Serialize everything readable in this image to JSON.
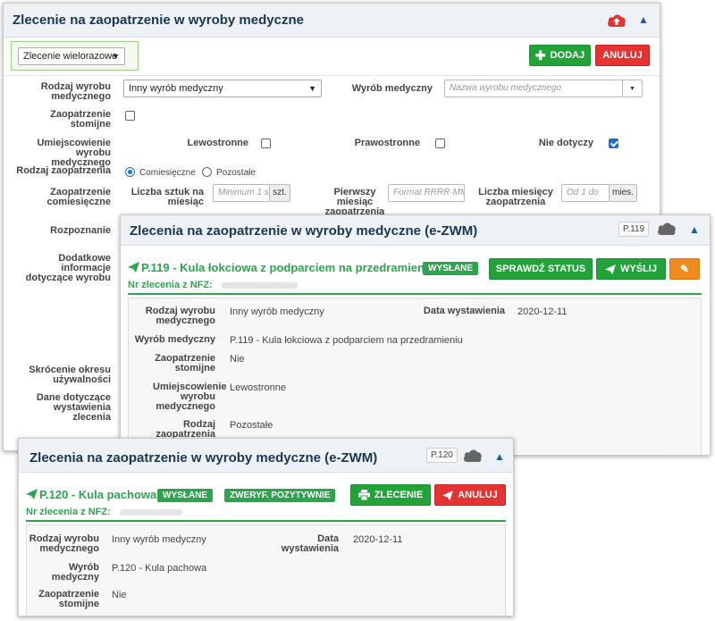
{
  "panel1": {
    "title": "Zlecenie na zaopatrzenie w wyroby medyczne",
    "type_select": "Zlecenie wielorazowe",
    "add_label": "DODAJ",
    "cancel_label": "ANULUJ",
    "rodzaj_wyrobu_label": "Rodzaj wyrobu medycznego",
    "rodzaj_wyrobu_value": "Inny wyrób medyczny",
    "wyrob_label": "Wyrób medyczny",
    "wyrob_placeholder": "Nazwa wyrobu medycznego",
    "stomijne_label": "Zaopatrzenie stomijne",
    "umiejscowienie_label": "Umiejscowienie wyrobu medycznego",
    "lewostronne": "Lewostronne",
    "prawostronne": "Prawostronne",
    "nie_dotyczy": "Nie dotyczy",
    "rodzaj_zaop_label": "Rodzaj zaopatrzenia",
    "comiesieczne": "Comiesięczne",
    "pozostale": "Pozostałe",
    "zaop_comiesieczne_label": "Zaopatrzenie comiesięczne",
    "liczba_sztuk_label": "Liczba sztuk na miesiąc",
    "liczba_sztuk_placeholder": "Minimum 1 s",
    "szt": "szt.",
    "pierwszy_label": "Pierwszy miesiąc zaopatrzenia",
    "pierwszy_placeholder": "Format RRRR-MM",
    "liczba_miesiecy_label": "Liczba miesięcy zaopatrzenia",
    "liczba_miesiecy_placeholder": "Od 1 do",
    "mies": "mies.",
    "rozpoznanie_label": "Rozpoznanie",
    "dodatkowe_label": "Dodatkowe informacje dotyczące wyrobu",
    "skrocenie_label": "Skrócenie okresu używalności",
    "dane_label": "Dane dotyczące wystawienia zlecenia"
  },
  "panel2": {
    "title": "Zlecenia na zaopatrzenie w wyroby medyczne (e-ZWM)",
    "badge": "P.119",
    "item_title": "P.119 - Kula łokciowa z podparciem na przedramieniu",
    "status": "WYSŁANE",
    "check_status": "SPRAWDŹ STATUS",
    "send": "WYŚLIJ",
    "nfz_label": "Nr zlecenia z NFZ:",
    "rodzaj_label": "Rodzaj wyrobu medycznego",
    "rodzaj_value": "Inny wyrób medyczny",
    "data_label": "Data wystawienia",
    "data_value": "2020-12-11",
    "wyrob_label": "Wyrób medyczny",
    "wyrob_value": "P.119 - Kula łokciowa z podparciem na przedramieniu",
    "stomijne_label": "Zaopatrzenie stomijne",
    "stomijne_value": "Nie",
    "umiejscowienie_label": "Umiejscowienie wyrobu medycznego",
    "umiejscowienie_value": "Lewostronne",
    "rodzaj_zaop_label": "Rodzaj zaopatrzenia",
    "rodzaj_zaop_value": "Pozostałe"
  },
  "panel3": {
    "title": "Zlecenia na zaopatrzenie w wyroby medyczne (e-ZWM)",
    "badge": "P.120",
    "item_title": "P.120 - Kula pachowa",
    "status": "WYSŁANE",
    "verified": "ZWERYF. POZYTYWNIE",
    "zlecenie": "ZLECENIE",
    "cancel": "ANULUJ",
    "nfz_label": "Nr zlecenia z NFZ:",
    "rodzaj_label": "Rodzaj wyrobu medycznego",
    "rodzaj_value": "Inny wyrób medyczny",
    "data_label": "Data wystawienia",
    "data_value": "2020-12-11",
    "wyrob_label": "Wyrób medyczny",
    "wyrob_value": "P.120 - Kula pachowa",
    "stomijne_label": "Zaopatrzenie stomijne",
    "stomijne_value": "Nie"
  },
  "colors": {
    "green": "#22a33a",
    "red": "#e53333",
    "orange": "#f08c1e",
    "title": "#1c3550",
    "link": "#1c5d9a"
  },
  "icons": [
    "cloud-upload-icon",
    "chevron-up-icon",
    "plus-icon",
    "send-icon",
    "pencil-icon",
    "printer-icon",
    "cloud-icon",
    "caret-down-icon"
  ]
}
